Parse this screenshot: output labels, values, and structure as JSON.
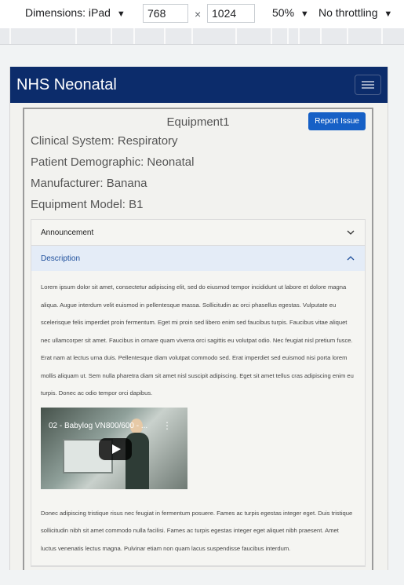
{
  "devtools": {
    "dimensions_label": "Dimensions: iPad",
    "width": "768",
    "height": "1024",
    "times": "×",
    "zoom": "50%",
    "throttling": "No throttling",
    "caret": "▼"
  },
  "navbar": {
    "brand": "NHS Neonatal"
  },
  "equipment": {
    "title": "Equipment1",
    "report_button": "Report Issue",
    "clinical_system": "Clinical System: Respiratory",
    "patient_demographic": "Patient Demographic: Neonatal",
    "manufacturer": "Manufacturer: Banana",
    "model": "Equipment Model: B1"
  },
  "accordion": {
    "announcement_label": "Announcement",
    "description_label": "Description",
    "description_p1": "Lorem ipsum dolor sit amet, consectetur adipiscing elit, sed do eiusmod tempor incididunt ut labore et dolore magna aliqua. Augue interdum velit euismod in pellentesque massa. Sollicitudin ac orci phasellus egestas. Vulputate eu scelerisque felis imperdiet proin fermentum. Eget mi proin sed libero enim sed faucibus turpis. Faucibus vitae aliquet nec ullamcorper sit amet. Faucibus in ornare quam viverra orci sagittis eu volutpat odio. Nec feugiat nisl pretium fusce. Erat nam at lectus urna duis. Pellentesque diam volutpat commodo sed. Erat imperdiet sed euismod nisi porta lorem mollis aliquam ut. Sem nulla pharetra diam sit amet nisl suscipit adipiscing. Eget sit amet tellus cras adipiscing enim eu turpis. Donec ac odio tempor orci dapibus.",
    "video_title": "02 - Babylog VN800/600 - ...",
    "video_menu": "⋮",
    "description_p2": "Donec adipiscing tristique risus nec feugiat in fermentum posuere. Fames ac turpis egestas integer eget. Duis tristique sollicitudin nibh sit amet commodo nulla facilisi. Fames ac turpis egestas integer eget aliquet nibh praesent. Amet luctus venenatis lectus magna. Pulvinar etiam non quam lacus suspendisse faucibus interdum."
  },
  "colors": {
    "navbar": "#0c2c6b",
    "report_button": "#1660c6",
    "accordion_open": "#e4ecf7"
  }
}
